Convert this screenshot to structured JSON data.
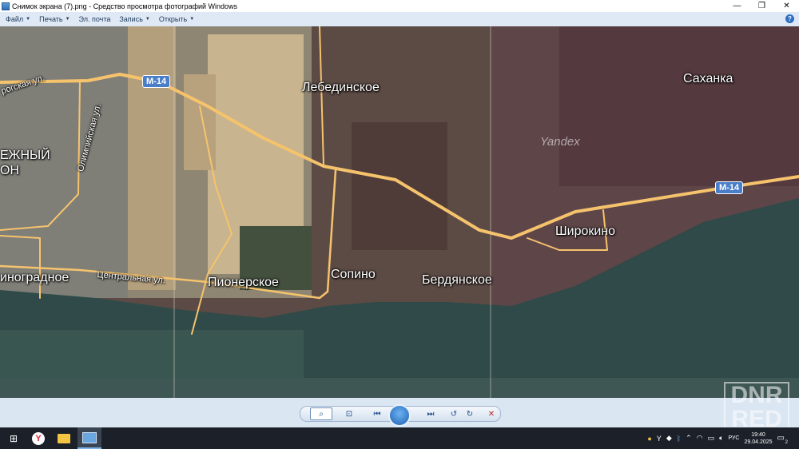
{
  "window": {
    "title": "Снимок экрана (7).png - Средство просмотра фотографий Windows",
    "minimize": "—",
    "maximize": "❐",
    "close": "✕"
  },
  "menu": {
    "items": [
      {
        "label": "Файл"
      },
      {
        "label": "Печать"
      },
      {
        "label": "Эл. почта"
      },
      {
        "label": "Запись"
      },
      {
        "label": "Открыть"
      }
    ],
    "help": "?"
  },
  "map": {
    "places": {
      "lebedinskoe": "Лебединское",
      "sakhanka": "Саханка",
      "shirokino": "Широкино",
      "sopino": "Сопино",
      "berdyanskoe": "Бердянское",
      "pionerskoe": "Пионерское",
      "vinogradnoe": "иноградное",
      "district_line1": "ЕЖНЫЙ",
      "district_line2": "ОН"
    },
    "streets": {
      "taganrogskaya": "рогская ул.",
      "olimpiyskaya": "Олимпийская ул.",
      "tsentralnaya": "Центральная ул."
    },
    "road": "М-14",
    "provider": "Yandex"
  },
  "watermark": {
    "line1": "DNR",
    "line2": "RED"
  },
  "controls": {
    "zoom": "⌕",
    "fit": "⊡",
    "prev": "⏮",
    "next": "⏭",
    "rotate_left": "↺",
    "rotate_right": "↻",
    "delete": "✕"
  },
  "taskbar": {
    "lang": "РУС",
    "time": "19:40",
    "date": "29.04.2025",
    "notifications": "2"
  }
}
